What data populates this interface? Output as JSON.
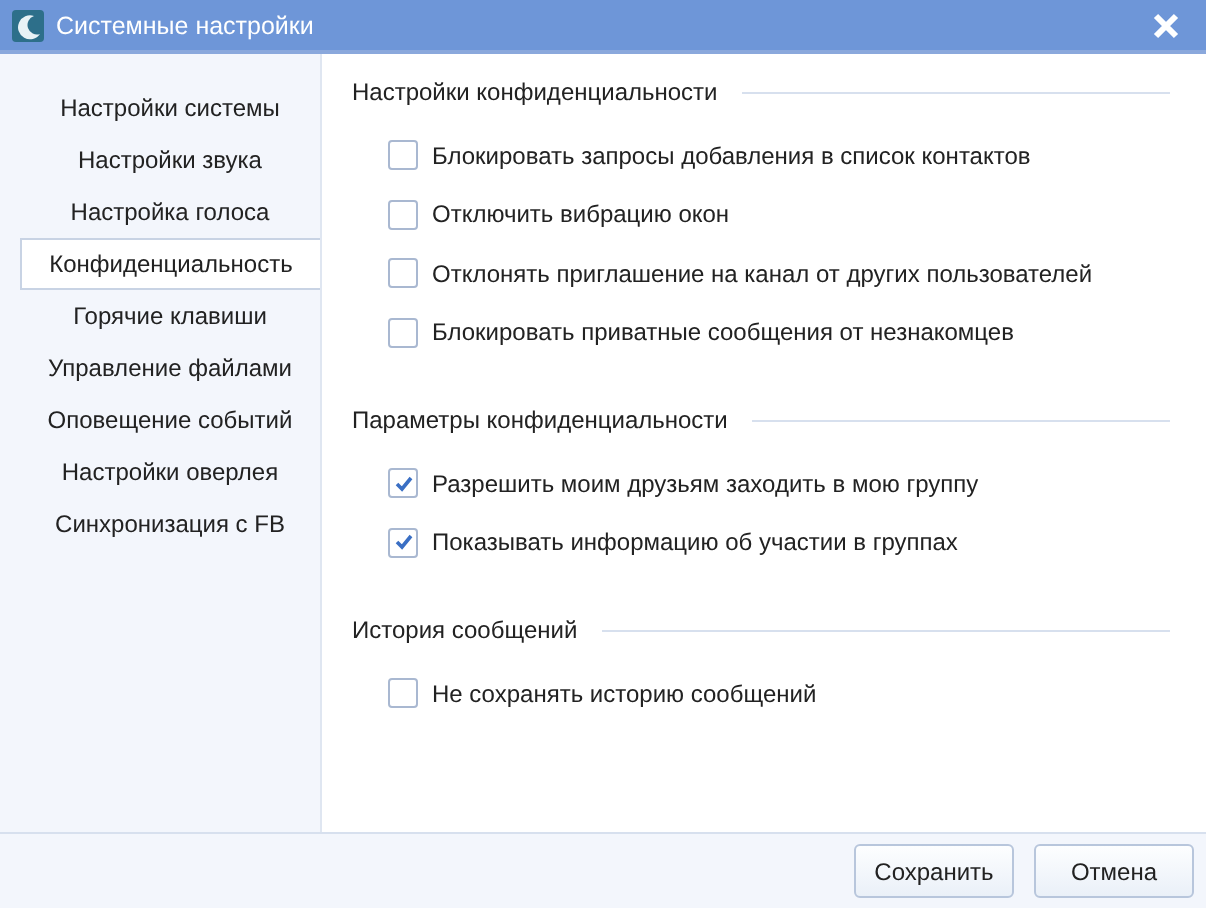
{
  "window": {
    "title": "Системные настройки"
  },
  "sidebar": {
    "items": [
      {
        "label": "Настройки системы",
        "selected": false
      },
      {
        "label": "Настройки звука",
        "selected": false
      },
      {
        "label": "Настройка голоса",
        "selected": false
      },
      {
        "label": "Конфиденциальность",
        "selected": true
      },
      {
        "label": "Горячие клавиши",
        "selected": false
      },
      {
        "label": "Управление файлами",
        "selected": false
      },
      {
        "label": "Оповещение событий",
        "selected": false
      },
      {
        "label": "Настройки оверлея",
        "selected": false
      },
      {
        "label": "Синхронизация с FB",
        "selected": false
      }
    ]
  },
  "sections": [
    {
      "title": "Настройки конфиденциальности",
      "options": [
        {
          "label": "Блокировать запросы добавления в список контактов",
          "checked": false
        },
        {
          "label": "Отключить вибрацию окон",
          "checked": false
        },
        {
          "label": "Отклонять приглашение на канал от других пользователей",
          "checked": false
        },
        {
          "label": "Блокировать приватные сообщения от незнакомцев",
          "checked": false
        }
      ]
    },
    {
      "title": "Параметры конфиденциальности",
      "options": [
        {
          "label": "Разрешить моим друзьям заходить в мою группу",
          "checked": true
        },
        {
          "label": "Показывать информацию об участии в группах",
          "checked": true
        }
      ]
    },
    {
      "title": "История сообщений",
      "options": [
        {
          "label": "Не сохранять историю сообщений",
          "checked": false
        }
      ]
    }
  ],
  "buttons": [
    "Сохранить",
    "Отмена"
  ]
}
